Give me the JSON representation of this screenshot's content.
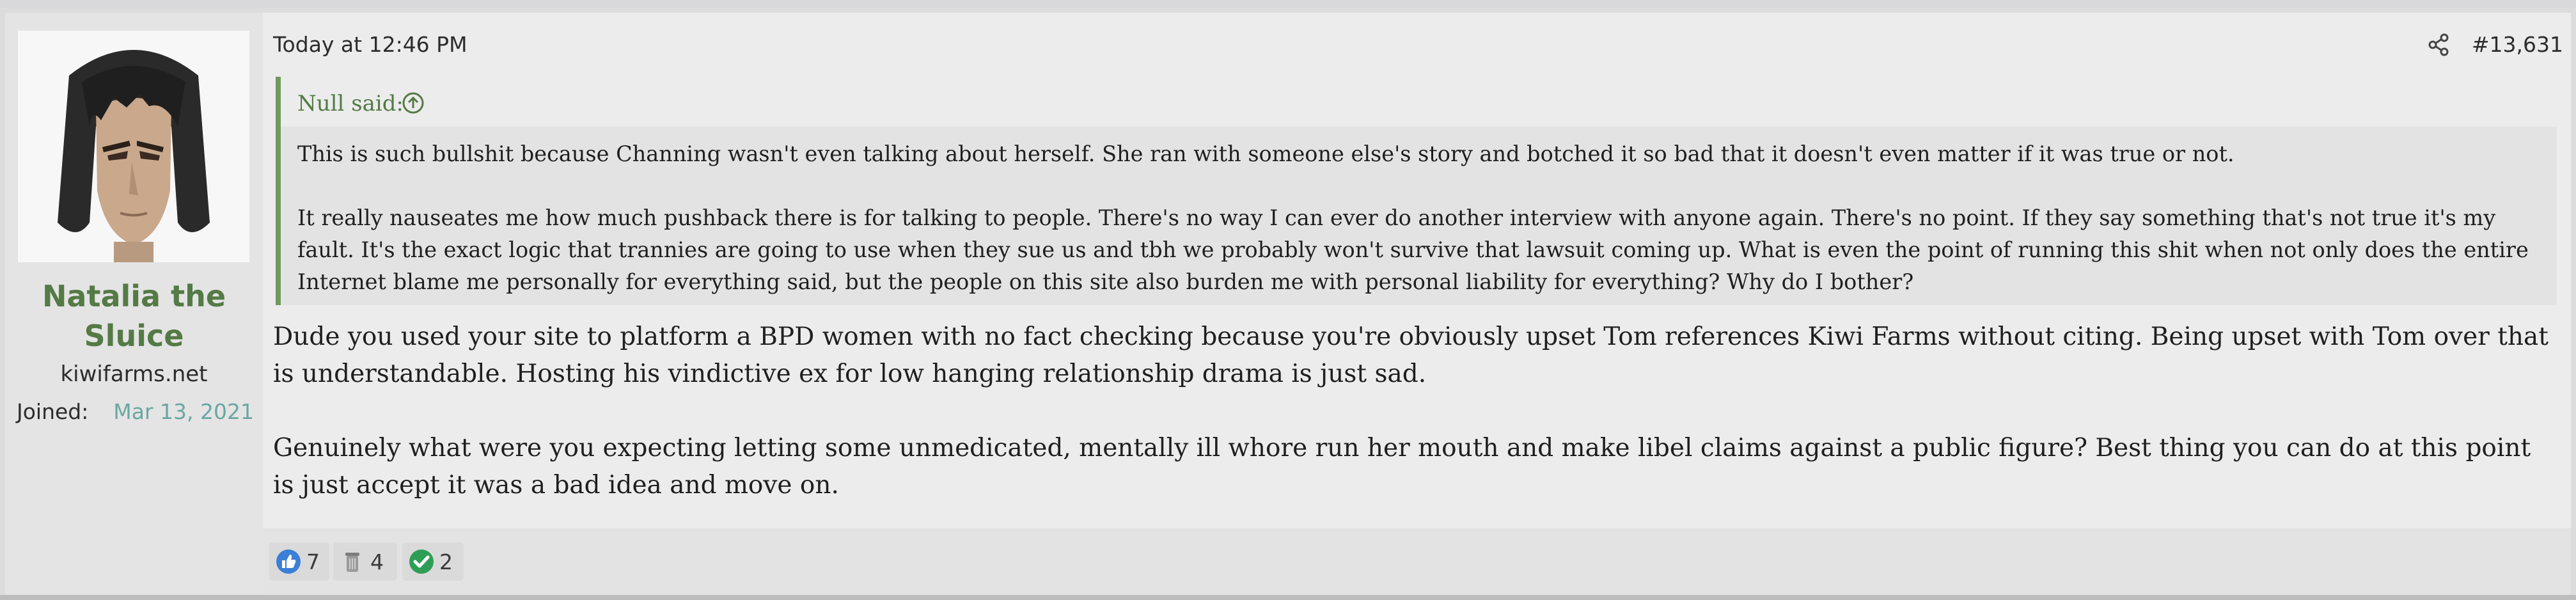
{
  "user": {
    "name": "Natalia the Sluice",
    "title": "kiwifarms.net",
    "joined_label": "Joined:",
    "joined_date": "Mar 13, 2021"
  },
  "post": {
    "timestamp": "Today at 12:46 PM",
    "number": "#13,631",
    "share_icon": "share-icon"
  },
  "quote": {
    "author": "Null said:",
    "paragraphs": [
      "This is such bullshit because Channing wasn't even talking about herself. She ran with someone else's story and botched it so bad that it doesn't even matter if it was true or not.",
      "It really nauseates me how much pushback there is for talking to people. There's no way I can ever do another interview with anyone again. There's no point. If they say something that's not true it's my fault. It's the exact logic that trannies are going to use when they sue us and tbh we probably won't survive that lawsuit coming up. What is even the point of running this shit when not only does the entire Internet blame me personally for everything said, but the people on this site also burden me with personal liability for everything? Why do I bother?"
    ]
  },
  "message": {
    "paragraphs": [
      "Dude you used your site to platform a BPD women with no fact checking because you're obviously upset Tom references Kiwi Farms without citing. Being upset with Tom over that is understandable. Hosting his vindictive ex for low hanging relationship drama is just sad.",
      "Genuinely what were you expecting letting some unmedicated, mentally ill whore run her mouth and make libel claims against a public figure? Best thing you can do at this point is just accept it was a bad idea and move on."
    ]
  },
  "reactions": [
    {
      "icon": "thumbs-up-icon",
      "count": "7",
      "color": "#3b7fd6"
    },
    {
      "icon": "trash-can-icon",
      "count": "4",
      "color": "#9a9a9a"
    },
    {
      "icon": "checkmark-icon",
      "count": "2",
      "color": "#2e9e56"
    }
  ],
  "colors": {
    "accent_green": "#547a45",
    "date_teal": "#6aa7a2",
    "quote_border": "#6f9a5d"
  }
}
